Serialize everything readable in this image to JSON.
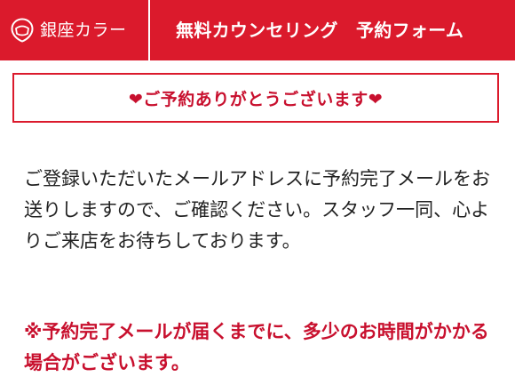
{
  "colors": {
    "brand_red": "#db1a2c",
    "accent_red": "#c8102e",
    "text": "#222222",
    "background": "#ffffff"
  },
  "header": {
    "logo_icon": "ginza-calla-logo-icon",
    "brand_name": "銀座カラー",
    "title": "無料カウンセリング　予約フォーム"
  },
  "thanks": {
    "message": "❤ご予約ありがとうございます❤"
  },
  "body": {
    "message": "ご登録いただいたメールアドレスに予約完了メールをお送りしますので、ご確認ください。スタッフ一同、心よりご来店をお待ちしております。"
  },
  "notice": {
    "message": "※予約完了メールが届くまでに、多少のお時間がかかる場合がございます。"
  }
}
